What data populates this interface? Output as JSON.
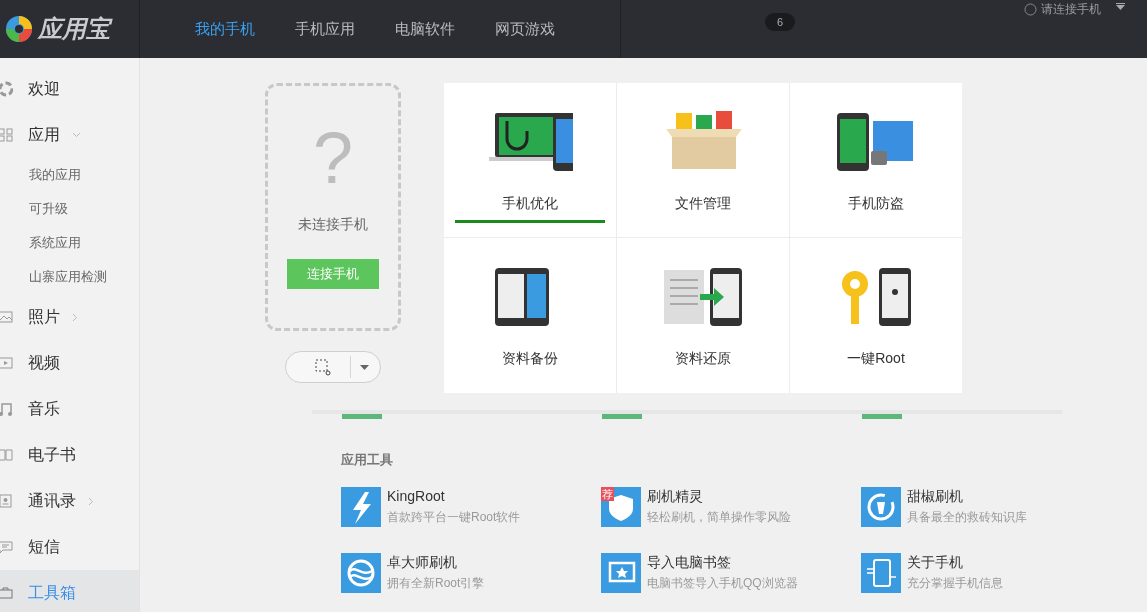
{
  "app": {
    "name": "应用宝"
  },
  "nav_tabs": [
    {
      "label": "我的手机",
      "selected": true
    },
    {
      "label": "手机应用",
      "selected": false
    },
    {
      "label": "电脑软件",
      "selected": false
    },
    {
      "label": "网页游戏",
      "selected": false
    }
  ],
  "badge": "6",
  "connect_link": "请连接手机",
  "sidebar": [
    {
      "label": "欢迎",
      "kind": "top",
      "selected": false
    },
    {
      "label": "应用",
      "kind": "group",
      "expanded": true,
      "selected": false
    },
    {
      "label": "我的应用",
      "kind": "sub",
      "selected": false
    },
    {
      "label": "可升级",
      "kind": "sub",
      "selected": false
    },
    {
      "label": "系统应用",
      "kind": "sub",
      "selected": false
    },
    {
      "label": "山寨应用检测",
      "kind": "sub",
      "selected": false
    },
    {
      "label": "照片",
      "kind": "group",
      "expanded": false,
      "selected": false
    },
    {
      "label": "视频",
      "kind": "top",
      "selected": false
    },
    {
      "label": "音乐",
      "kind": "top",
      "selected": false
    },
    {
      "label": "电子书",
      "kind": "top",
      "selected": false
    },
    {
      "label": "通讯录",
      "kind": "group",
      "expanded": false,
      "selected": false
    },
    {
      "label": "短信",
      "kind": "top",
      "selected": false
    },
    {
      "label": "工具箱",
      "kind": "top",
      "selected": true
    }
  ],
  "phone_card": {
    "symbol": "?",
    "status": "未连接手机",
    "button": "连接手机"
  },
  "tools": [
    {
      "label": "手机优化",
      "selected": true
    },
    {
      "label": "文件管理",
      "selected": false
    },
    {
      "label": "手机防盗",
      "selected": false
    },
    {
      "label": "资料备份",
      "selected": false
    },
    {
      "label": "资料还原",
      "selected": false
    },
    {
      "label": "一键Root",
      "selected": false
    }
  ],
  "app_tools": {
    "title": "应用工具",
    "items": [
      {
        "name": "KingRoot",
        "desc": "首款跨平台一键Root软件"
      },
      {
        "name": "刷机精灵",
        "desc": "轻松刷机，简单操作零风险",
        "tag": "荐"
      },
      {
        "name": "甜椒刷机",
        "desc": "具备最全的救砖知识库"
      },
      {
        "name": "卓大师刷机",
        "desc": "拥有全新Root引擎"
      },
      {
        "name": "导入电脑书签",
        "desc": "电脑书签导入手机QQ浏览器"
      },
      {
        "name": "关于手机",
        "desc": "充分掌握手机信息"
      }
    ]
  }
}
